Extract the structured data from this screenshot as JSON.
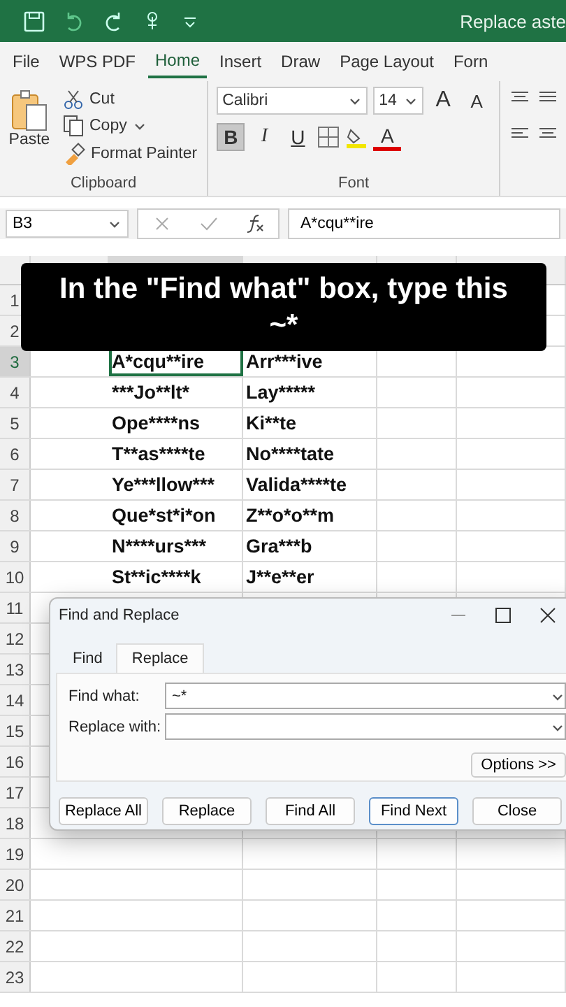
{
  "title_bar": {
    "title": "Replace aste"
  },
  "menu_tabs": [
    {
      "label": "File",
      "selected": false
    },
    {
      "label": "WPS PDF",
      "selected": false
    },
    {
      "label": "Home",
      "selected": true
    },
    {
      "label": "Insert",
      "selected": false
    },
    {
      "label": "Draw",
      "selected": false
    },
    {
      "label": "Page Layout",
      "selected": false
    },
    {
      "label": "Forn",
      "selected": false
    }
  ],
  "clipboard": {
    "paste": "Paste",
    "cut": "Cut",
    "copy": "Copy",
    "format_painter": "Format Painter",
    "group_label": "Clipboard"
  },
  "font": {
    "name": "Calibri",
    "size": "14",
    "grow": "A",
    "shrink": "A",
    "bold": {
      "label": "B",
      "on": true
    },
    "italic": "I",
    "underline": "U",
    "font_color": "A",
    "group_label": "Font"
  },
  "formula_bar": {
    "name_box": "B3",
    "formula": "A*cqu**ire"
  },
  "sheet": {
    "rows": [
      {
        "number": "1"
      },
      {
        "number": "2"
      },
      {
        "number": "3",
        "cells": [
          {
            "text": "A*cqu**ire",
            "selected": true
          },
          {
            "text": "Arr***ive",
            "selected": false
          }
        ]
      },
      {
        "number": "4",
        "cells": [
          {
            "text": "***Jo**lt*",
            "selected": false
          },
          {
            "text": "Lay*****",
            "selected": false
          }
        ]
      },
      {
        "number": "5",
        "cells": [
          {
            "text": "Ope****ns",
            "selected": false
          },
          {
            "text": "Ki**te",
            "selected": false
          }
        ]
      },
      {
        "number": "6",
        "cells": [
          {
            "text": "T**as****te",
            "selected": false
          },
          {
            "text": "No****tate",
            "selected": false
          }
        ]
      },
      {
        "number": "7",
        "cells": [
          {
            "text": "Ye***llow***",
            "selected": false
          },
          {
            "text": "Valida****te",
            "selected": false
          }
        ]
      },
      {
        "number": "8",
        "cells": [
          {
            "text": "Que*st*i*on",
            "selected": false
          },
          {
            "text": "Z**o*o**m",
            "selected": false
          }
        ]
      },
      {
        "number": "9",
        "cells": [
          {
            "text": "N****urs***",
            "selected": false
          },
          {
            "text": "Gra***b",
            "selected": false
          }
        ]
      },
      {
        "number": "10",
        "cells": [
          {
            "text": "St**ic****k",
            "selected": false
          },
          {
            "text": "J**e**er",
            "selected": false
          }
        ]
      },
      {
        "number": "11"
      },
      {
        "number": "12"
      },
      {
        "number": "13"
      },
      {
        "number": "14"
      },
      {
        "number": "15"
      },
      {
        "number": "16"
      },
      {
        "number": "17"
      },
      {
        "number": "18"
      },
      {
        "number": "19"
      },
      {
        "number": "20"
      },
      {
        "number": "21"
      },
      {
        "number": "22"
      },
      {
        "number": "23"
      }
    ]
  },
  "caption": {
    "lines": [
      "In the \"Find what\" box, type this",
      "~*"
    ]
  },
  "dialog": {
    "title": "Find and Replace",
    "tabs": [
      {
        "label": "Find",
        "selected": false
      },
      {
        "label": "Replace",
        "selected": true
      }
    ],
    "find_label": "Find what:",
    "find_value": "~*",
    "replace_label": "Replace with:",
    "options_button": "Options >>",
    "buttons": [
      {
        "label": "Replace All",
        "selected": false
      },
      {
        "label": "Replace",
        "selected": false
      },
      {
        "label": "Find All",
        "selected": false
      },
      {
        "label": "Find Next",
        "selected": true
      },
      {
        "label": "Close",
        "selected": false
      }
    ]
  }
}
